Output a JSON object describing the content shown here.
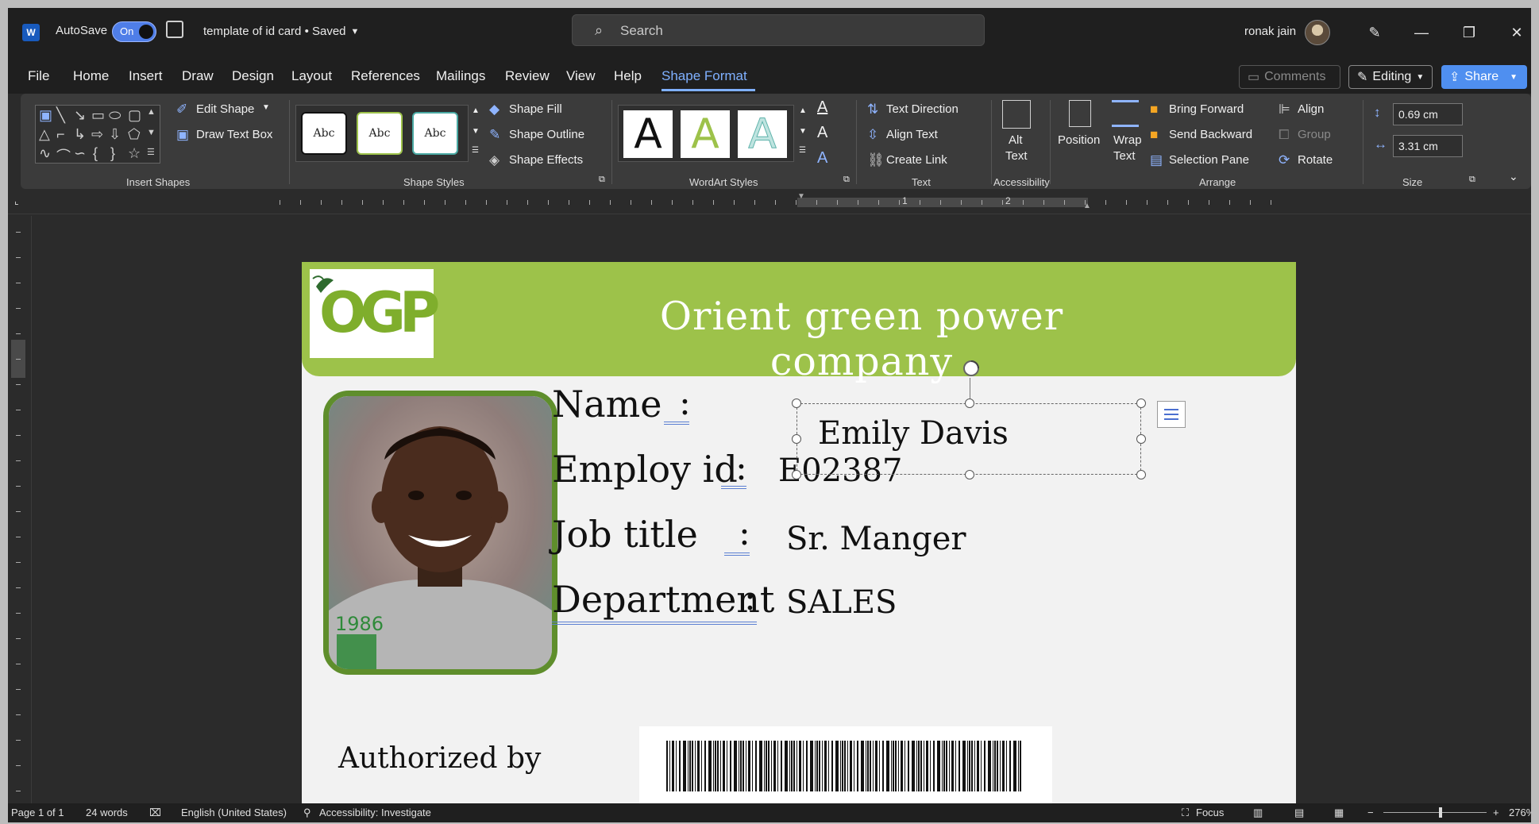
{
  "titlebar": {
    "app_letter": "W",
    "autosave_label": "AutoSave",
    "autosave_state": "On",
    "doc_title": "template of id card • Saved",
    "search_placeholder": "Search",
    "user_name": "ronak jain",
    "minimize": "—",
    "restore": "❐",
    "close": "✕"
  },
  "menu": {
    "tabs": [
      "File",
      "Home",
      "Insert",
      "Draw",
      "Design",
      "Layout",
      "References",
      "Mailings",
      "Review",
      "View",
      "Help",
      "Shape Format"
    ],
    "active_tab": "Shape Format",
    "comments": "Comments",
    "editing": "Editing",
    "share": "Share"
  },
  "ribbon": {
    "insert_shapes": {
      "label": "Insert Shapes",
      "edit_shape": "Edit Shape",
      "draw_text_box": "Draw Text Box"
    },
    "shape_styles": {
      "label": "Shape Styles",
      "sample": "Abc",
      "fill": "Shape Fill",
      "outline": "Shape Outline",
      "effects": "Shape Effects"
    },
    "wordart": {
      "label": "WordArt Styles",
      "sample": "A"
    },
    "text": {
      "label": "Text",
      "direction": "Text Direction",
      "align": "Align Text",
      "link": "Create Link"
    },
    "accessibility": {
      "label": "Accessibility",
      "alt_text_1": "Alt",
      "alt_text_2": "Text"
    },
    "arrange": {
      "label": "Arrange",
      "position": "Position",
      "wrap_1": "Wrap",
      "wrap_2": "Text",
      "bring_forward": "Bring Forward",
      "send_backward": "Send Backward",
      "selection_pane": "Selection Pane",
      "align": "Align",
      "group": "Group",
      "rotate": "Rotate"
    },
    "size": {
      "label": "Size",
      "height": "0.69 cm",
      "width": "3.31 cm"
    }
  },
  "ruler": {
    "num1": "1",
    "num2": "2"
  },
  "document": {
    "company": "Orient green power company",
    "logo_text": "OGP",
    "fields": [
      {
        "label": "Name",
        "value": "Emily Davis"
      },
      {
        "label": "Employ id",
        "value": "E02387"
      },
      {
        "label": "Job title",
        "value": "Sr. Manger"
      },
      {
        "label": "Department",
        "value": "SALES"
      }
    ],
    "colon": ":",
    "authorized": "Authorized by",
    "photo_shirt_text": "1986"
  },
  "status": {
    "page": "Page 1 of 1",
    "words": "24 words",
    "language": "English (United States)",
    "accessibility": "Accessibility: Investigate",
    "focus": "Focus",
    "zoom": "276%",
    "zoom_level": 0.55
  },
  "colors": {
    "header_green": "#9dc24a",
    "accent_blue": "#7fb0ff",
    "photo_border": "#5f8e2c"
  }
}
